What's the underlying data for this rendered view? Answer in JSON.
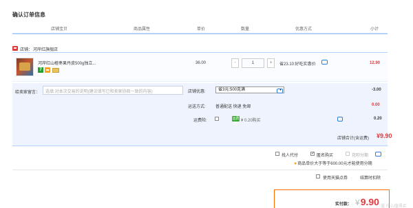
{
  "page": {
    "title": "确认订单信息"
  },
  "table_header": {
    "columns": [
      "店铺宝贝",
      "商品属性",
      "单价",
      "数量",
      "优惠方式",
      "小计"
    ]
  },
  "shop": {
    "prefix": "店铺：",
    "name": "河岸红旗舰店"
  },
  "item": {
    "title": "河岸红山楂枣果丹皮500g独立...",
    "badge_7": "7",
    "unit_price": "36.00",
    "quantity": "1",
    "minus_label": "-",
    "plus_label": "+",
    "promo_text": "省23.10:好吃实惠价",
    "subtotal": "12.90"
  },
  "options": {
    "message_label": "给卖家留言：",
    "message_placeholder": "选填:对本次交易的说明(建议填写已和卖家协商一致的内容)",
    "shop_discount_label": "店铺优惠:",
    "shop_discount_selected": "省3元:500克满",
    "shop_discount_amount": "-3.00",
    "shipping_label": "运送方式:",
    "shipping_value": "普通配送 快递 免邮",
    "shipping_amount": "0.00",
    "insurance_label": "运费险:",
    "insurance_tag": "运费险",
    "insurance_text": "¥ 0.20购买",
    "insurance_amount": "0.20",
    "shop_total_label": "店铺合计(含运费)",
    "shop_total_value": "¥9.90"
  },
  "order_options": {
    "proxy_pay": "找人代付",
    "anonymous": "匿名购买",
    "huabei": "花呗分期",
    "install_note": "商品单价大于等于600.00元才能使用分期",
    "tmall_points": "使用天猫点券",
    "settle_time": "结算时扣除"
  },
  "payment": {
    "label": "实付款：",
    "currency": "¥",
    "amount": "9.90"
  },
  "watermark": "值 什么值得买"
}
